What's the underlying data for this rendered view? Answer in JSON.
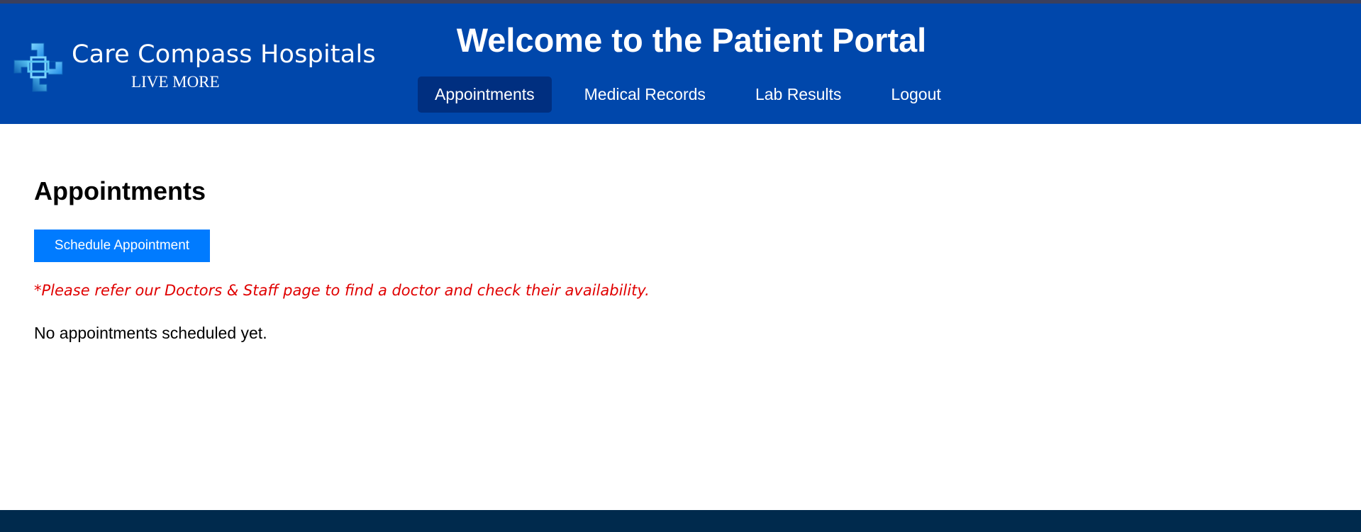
{
  "brand": {
    "name": "Care Compass Hospitals",
    "tagline": "LIVE MORE",
    "logo_icon": "medical-cross-icon",
    "logo_colors": [
      "#5bc8f5",
      "#1e88e5",
      "#0d5fb3"
    ]
  },
  "header": {
    "title": "Welcome to the Patient Portal",
    "background": "#0047ab"
  },
  "nav": {
    "items": [
      {
        "label": "Appointments",
        "active": true
      },
      {
        "label": "Medical Records",
        "active": false
      },
      {
        "label": "Lab Results",
        "active": false
      },
      {
        "label": "Logout",
        "active": false
      }
    ]
  },
  "main": {
    "heading": "Appointments",
    "schedule_button_label": "Schedule Appointment",
    "note": "*Please refer our Doctors & Staff page to find a doctor and check their availability.",
    "empty_message": "No appointments scheduled yet."
  },
  "colors": {
    "accent_button": "#007bff",
    "note_text": "#e00000",
    "footer": "#002a4d"
  }
}
